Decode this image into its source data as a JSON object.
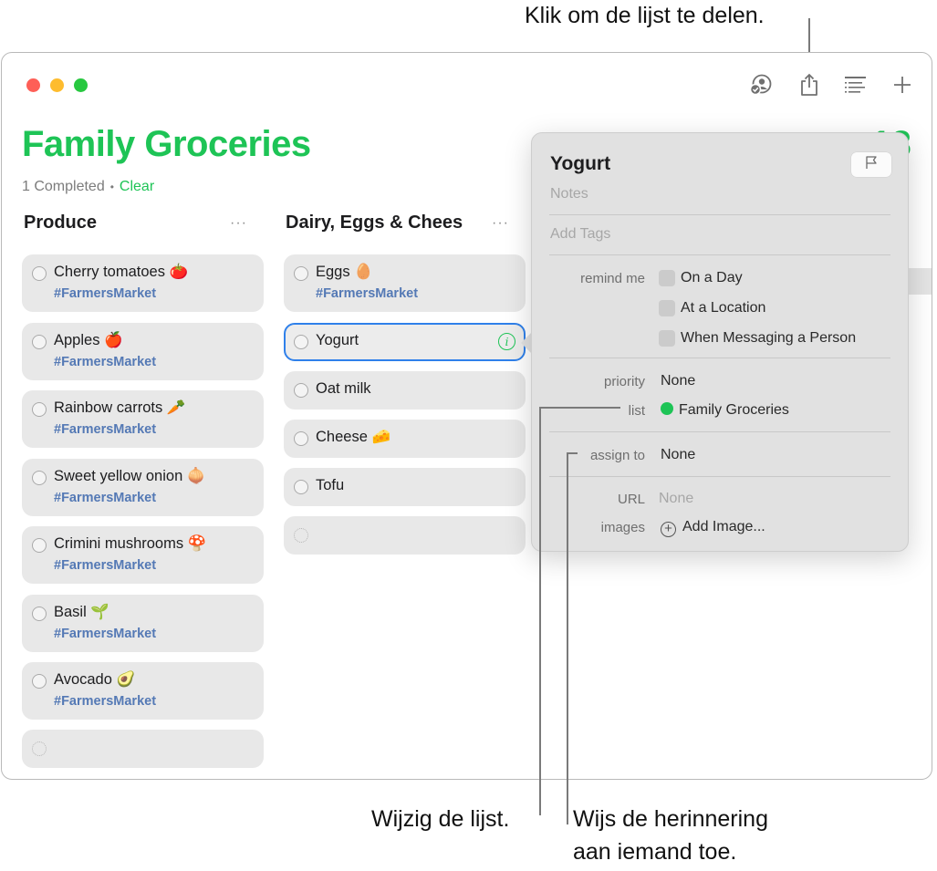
{
  "callouts": {
    "share": "Klik om de lijst te delen.",
    "change_list": "Wijzig de lijst.",
    "assign_line1": "Wijs de herinnering",
    "assign_line2": "aan iemand toe."
  },
  "window": {
    "toolbar": {
      "icons": [
        "collaboration-icon",
        "share-icon",
        "view-options-icon",
        "add-icon"
      ]
    },
    "list": {
      "title": "Family Groceries",
      "count": "13",
      "completed_text": "1 Completed",
      "separator": "•",
      "clear_label": "Clear",
      "accent_color": "#1ec456"
    },
    "columns": [
      {
        "header": "Produce",
        "more": "···",
        "items": [
          {
            "title": "Cherry tomatoes 🍅",
            "tag": "#FarmersMarket"
          },
          {
            "title": "Apples 🍎",
            "tag": "#FarmersMarket"
          },
          {
            "title": "Rainbow carrots 🥕",
            "tag": "#FarmersMarket"
          },
          {
            "title": "Sweet yellow onion 🧅",
            "tag": "#FarmersMarket"
          },
          {
            "title": "Crimini mushrooms 🍄",
            "tag": "#FarmersMarket"
          },
          {
            "title": "Basil 🌱",
            "tag": "#FarmersMarket"
          },
          {
            "title": "Avocado 🥑",
            "tag": "#FarmersMarket"
          }
        ]
      },
      {
        "header": "Dairy, Eggs & Chees",
        "more": "···",
        "items": [
          {
            "title": "Eggs 🥚",
            "tag": "#FarmersMarket"
          },
          {
            "title": "Yogurt",
            "tag": "",
            "selected": true
          },
          {
            "title": "Oat milk",
            "tag": ""
          },
          {
            "title": "Cheese 🧀",
            "tag": ""
          },
          {
            "title": "Tofu",
            "tag": ""
          }
        ]
      }
    ],
    "popover": {
      "title": "Yogurt",
      "notes_placeholder": "Notes",
      "tags_placeholder": "Add Tags",
      "remind_me_label": "remind me",
      "remind_options": [
        "On a Day",
        "At a Location",
        "When Messaging a Person"
      ],
      "priority_label": "priority",
      "priority_value": "None",
      "list_label": "list",
      "list_value": "Family Groceries",
      "assign_label": "assign to",
      "assign_value": "None",
      "url_label": "URL",
      "url_value": "None",
      "images_label": "images",
      "images_value": "Add Image..."
    }
  }
}
